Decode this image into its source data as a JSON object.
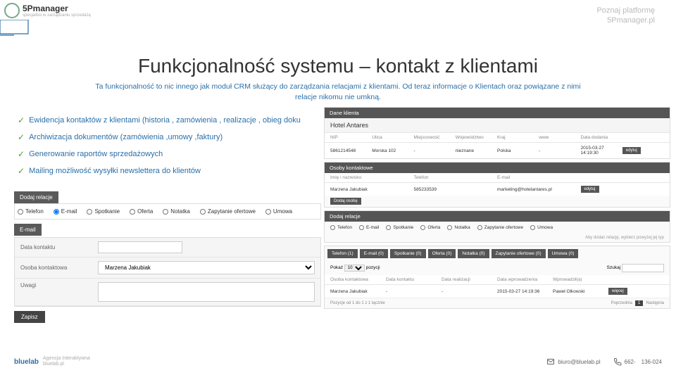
{
  "header": {
    "brand": "5Pmanager",
    "tagline": "specjaliści w zarządzaniu sprzedażą"
  },
  "top_right": {
    "line1": "Poznaj platformę",
    "line2": "5Pmanager.pl"
  },
  "title": "Funkcjonalność systemu – kontakt z klientami",
  "subtitle": "Ta funkcjonalność to nic innego jak moduł CRM służący do zarządzania relacjami z klientami. Od teraz informacje o Klientach oraz powiązane z nimi relacje nikomu nie umkną.",
  "bullets": [
    "Ewidencja kontaktów z klientami (historia , zamówienia , realizacje , obieg doku",
    "Archiwizacja dokumentów (zamówienia ,umowy ,faktury)",
    "Generowanie raportów sprzedażowych",
    "Mailing  możliwość wysyłki newslettera  do klientów"
  ],
  "left_panel": {
    "add_relation": "Dodaj relacje",
    "radios": [
      "Telefon",
      "E-mail",
      "Spotkanie",
      "Oferta",
      "Notatka",
      "Zapytanie ofertowe",
      "Umowa"
    ],
    "section": "E-mail",
    "rows": {
      "date": "Data kontaktu",
      "person": "Osoba kontaktowa",
      "person_val": "Marzena Jakubiak",
      "notes": "Uwagi"
    },
    "save": "Zapisz"
  },
  "right_panel": {
    "header": "Dane klienta",
    "client": "Hotel Antares",
    "cols1": [
      "NIP",
      "Ulica",
      "Miejscowość",
      "Województwo",
      "Kraj",
      "www",
      "Data dodania",
      ""
    ],
    "row1": [
      "5861214548",
      "Morska 102",
      "-",
      "nieznane",
      "Polska",
      "-",
      "2015-03-27 14:19:30",
      "edytuj"
    ],
    "header2": "Osoby kontaktowe",
    "cols2": [
      "Imię i nazwisko",
      "Telefon",
      "E-mail",
      ""
    ],
    "row2": [
      "Marzena Jakubiak",
      "585233539",
      "marketing@hotelantares.pl",
      "edytuj"
    ],
    "add_person": "Dodaj osobę",
    "add_relation": "Dodaj relacje",
    "radios": [
      "Telefon",
      "E-mail",
      "Spotkanie",
      "Oferta",
      "Notatka",
      "Zapytanie ofertowe",
      "Umowa"
    ],
    "hint": "Aby dodać relację, wybierz powyżej jej typ",
    "tabs": [
      "Telefon (1)",
      "E-mail (0)",
      "Spotkanie (0)",
      "Oferta (0)",
      "Notatka (0)",
      "Zapytanie ofertowe (0)",
      "Umowa (0)"
    ],
    "show": "Pokaż",
    "show_val": "10",
    "show_sfx": "pozycji",
    "search": "Szukaj",
    "cols3": [
      "Osoba kontaktowa",
      "Data kontaktu",
      "Data realizacji",
      "Data wprowadzenia",
      "Wprowadził(a)",
      ""
    ],
    "row3": [
      "Marzena Jakubiak",
      "-",
      "-",
      "2015-03-27 14:19:36",
      "Paweł Olkowski",
      "więcej"
    ],
    "footer_left": "Pozycje od 1 do 1 z 1 łącznie",
    "prev": "Poprzednia",
    "page": "1",
    "next": "Następna"
  },
  "footer": {
    "logo": "bluelab",
    "l1": "Agencja Interaktywna",
    "l2": "bluelab.pl",
    "email": "biuro@bluelab.pl",
    "phone1": "662-",
    "phone2": "136-024"
  }
}
